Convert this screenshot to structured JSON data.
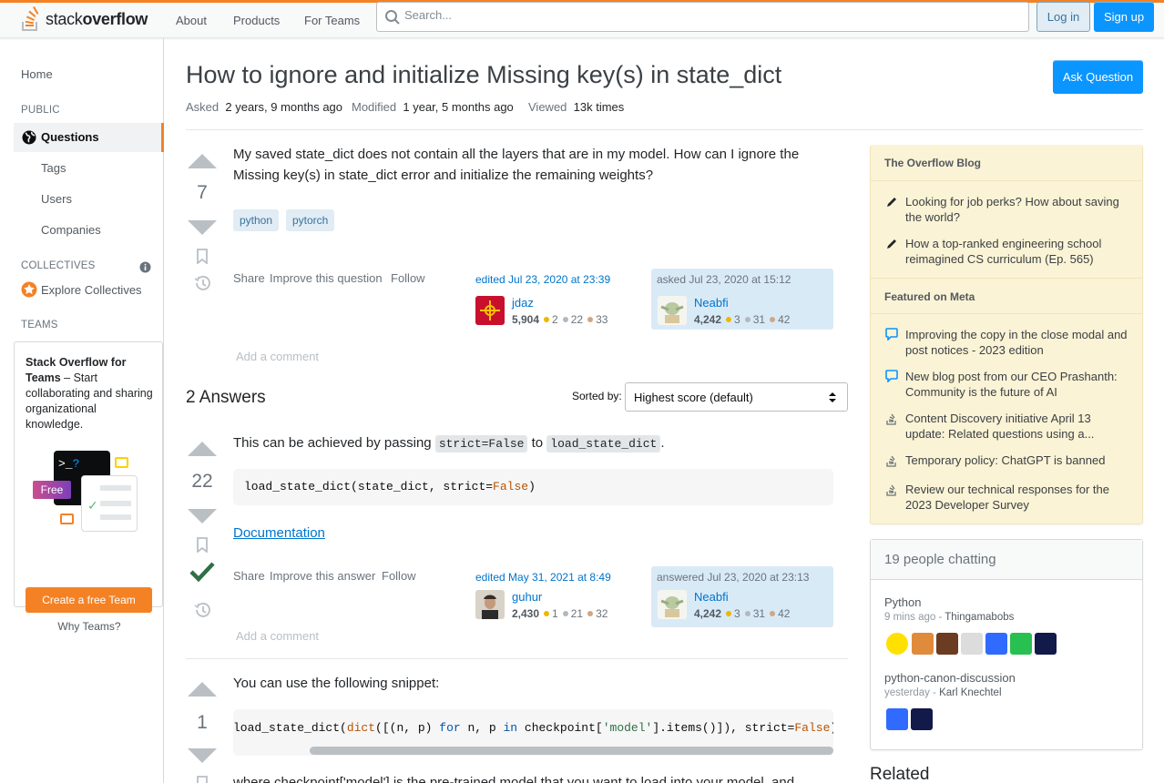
{
  "header": {
    "logo_text_light": "stack",
    "logo_text_bold": "overflow",
    "nav": [
      "About",
      "Products",
      "For Teams"
    ],
    "search_placeholder": "Search...",
    "login": "Log in",
    "signup": "Sign up"
  },
  "sidebar": {
    "home": "Home",
    "public_heading": "PUBLIC",
    "questions": "Questions",
    "tags": "Tags",
    "users": "Users",
    "companies": "Companies",
    "collectives_heading": "COLLECTIVES",
    "explore_collectives": "Explore Collectives",
    "teams_heading": "TEAMS",
    "teams_title": "Stack Overflow for Teams",
    "teams_desc": " – Start collaborating and sharing organizational knowledge.",
    "teams_free_badge": "Free",
    "create_team": "Create a free Team",
    "why_teams": "Why Teams?"
  },
  "question": {
    "title": "How to ignore and initialize Missing key(s) in state_dict",
    "ask_button": "Ask Question",
    "asked_label": "Asked",
    "asked_value": "2 years, 9 months ago",
    "modified_label": "Modified",
    "modified_value": "1 year, 5 months ago",
    "viewed_label": "Viewed",
    "viewed_value": "13k times",
    "votes": "7",
    "body": "My saved state_dict does not contain all the layers that are in my model. How can I ignore the Missing key(s) in state_dict error and initialize the remaining weights?",
    "tags": [
      "python",
      "pytorch"
    ],
    "share": "Share",
    "improve": "Improve this question",
    "follow": "Follow",
    "editor": {
      "action": "edited Jul 23, 2020 at 23:39",
      "name": "jdaz",
      "rep": "5,904",
      "gold": "2",
      "silver": "22",
      "bronze": "33"
    },
    "owner": {
      "action": "asked Jul 23, 2020 at 15:12",
      "name": "Neabfi",
      "rep": "4,242",
      "gold": "3",
      "silver": "31",
      "bronze": "42"
    },
    "add_comment": "Add a comment"
  },
  "answers_header": {
    "count": "2 Answers",
    "sorted_by": "Sorted by:",
    "sort_value": "Highest score (default)"
  },
  "answer1": {
    "votes": "22",
    "text_before": "This can be achieved by passing ",
    "code1": "strict=False",
    "text_mid": " to ",
    "code2": "load_state_dict",
    "text_after": ".",
    "code_plain": "load_state_dict(state_dict, strict=",
    "code_kw": "False",
    "code_end": ")",
    "doc_link": "Documentation",
    "share": "Share",
    "improve": "Improve this answer",
    "follow": "Follow",
    "editor": {
      "action": "edited May 31, 2021 at 8:49",
      "name": "guhur",
      "rep": "2,430",
      "gold": "1",
      "silver": "21",
      "bronze": "32"
    },
    "owner": {
      "action": "answered Jul 23, 2020 at 23:13",
      "name": "Neabfi",
      "rep": "4,242",
      "gold": "3",
      "silver": "31",
      "bronze": "42"
    },
    "add_comment": "Add a comment"
  },
  "answer2": {
    "votes": "1",
    "text": "You can use the following snippet:",
    "code_a": "load_state_dict(",
    "code_b": "dict",
    "code_c": "([(n, p) ",
    "code_d": "for",
    "code_e": " n, p ",
    "code_f": "in",
    "code_g": " checkpoint[",
    "code_h": "'model'",
    "code_i": "].items()]), strict=",
    "code_j": "False",
    "code_k": ")",
    "text_cut": "where checkpoint['model'] is the pre-trained model that you want to load into your model, and"
  },
  "blog": {
    "heading1": "The Overflow Blog",
    "items1": [
      "Looking for job perks? How about saving the world?",
      "How a top-ranked engineering school reimagined CS curriculum (Ep. 565)"
    ],
    "heading2": "Featured on Meta",
    "items2": [
      "Improving the copy in the close modal and post notices - 2023 edition",
      "New blog post from our CEO Prashanth: Community is the future of AI",
      "Content Discovery initiative April 13 update: Related questions using a...",
      "Temporary policy: ChatGPT is banned",
      "Review our technical responses for the 2023 Developer Survey"
    ]
  },
  "chat": {
    "heading": "19 people chatting",
    "room1": "Python",
    "room1_time": "9 mins ago",
    "room1_user": "Thingamabobs",
    "room2": "python-canon-discussion",
    "room2_time": "yesterday",
    "room2_user": "Karl Knechtel"
  },
  "related_heading": "Related",
  "colors": {
    "accent": "#f48225",
    "primary": "#0a95ff",
    "link": "#0074cc",
    "accepted": "#2f6f44"
  }
}
